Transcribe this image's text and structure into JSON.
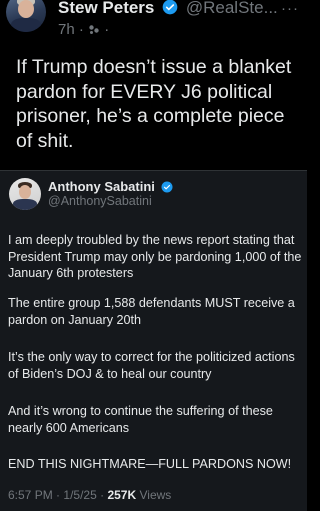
{
  "post": {
    "author_name": "Stew Peters",
    "author_handle": "@RealSte...",
    "time": "7h",
    "more_label": "···",
    "text": "If Trump doesn’t issue a blanket pardon for EVERY J6 political prisoner, he’s a complete piece of shit."
  },
  "quoted": {
    "author_name": "Anthony Sabatini",
    "author_handle": "@AnthonySabatini",
    "paragraphs": [
      "I am deeply troubled by the news report stating that President Trump may only be pardoning 1,000 of the January 6th protesters",
      "The entire group 1,588 defendants MUST receive a pardon on January 20th",
      "It’s the only way to correct for the politicized actions of Biden’s DOJ & to heal our country",
      "And it’s wrong to continue the suffering of these nearly 600 Americans",
      "END THIS NIGHTMARE—FULL PARDONS NOW!"
    ],
    "time": "6:57 PM",
    "date": "1/5/25",
    "views_count": "257K",
    "views_label": "Views"
  },
  "colors": {
    "background": "#000000",
    "card_background": "#15181c",
    "text": "#e7e9ea",
    "muted": "#71767b",
    "verified": "#1d9bf0"
  },
  "icons": {
    "verified": "verified-badge-icon",
    "circles": "circles-icon",
    "more": "more-icon"
  }
}
